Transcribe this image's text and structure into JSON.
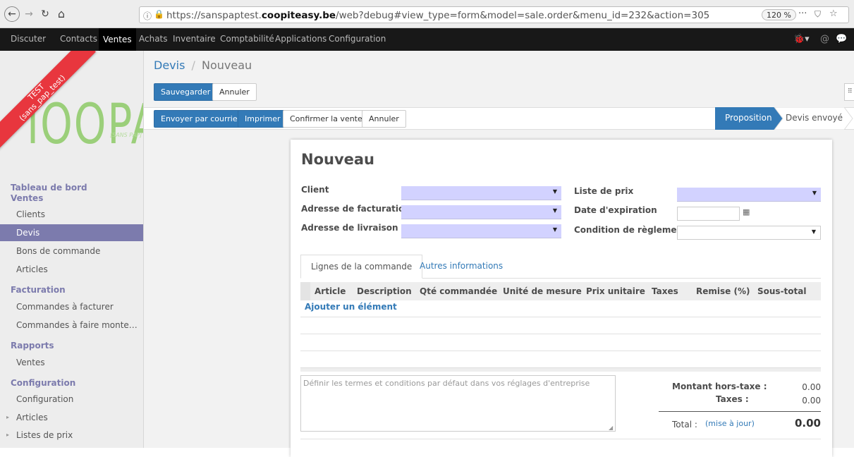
{
  "browser": {
    "back": "←",
    "forward": "→",
    "reload": "↻",
    "home": "⌂",
    "url_prefix": "https://sanspaptest.",
    "url_domain": "coopiteasy.be",
    "url_rest": "/web?debug#view_type=form&model=sale.order&menu_id=232&action=305",
    "zoom": "120 %",
    "menu_dots": "···",
    "pocket_icon": "pocket-icon",
    "star_icon": "star-icon"
  },
  "topbar": {
    "menus": [
      "Discuter",
      "Contacts",
      "Ventes",
      "Achats",
      "Inventaire",
      "Comptabilité",
      "Applications",
      "Configuration"
    ],
    "active": "Ventes"
  },
  "sidebar": {
    "ribbon_line1": "TEST",
    "ribbon_line2": "(sans_pap_test)",
    "logo": "IOOPAP",
    "logo_sub": "[SANS PAP]",
    "sections": [
      {
        "title": "Tableau de bord",
        "subtitle": "Ventes"
      },
      {
        "title": "Facturation"
      },
      {
        "title": "Rapports"
      },
      {
        "title": "Configuration"
      }
    ],
    "items": [
      "Clients",
      "Devis",
      "Bons de commande",
      "Articles",
      "Commandes à facturer",
      "Commandes à faire monte…",
      "Ventes",
      "Configuration",
      "Articles",
      "Listes de prix"
    ],
    "active_item": "Devis"
  },
  "breadcrumb": {
    "parent": "Devis",
    "sep": "/",
    "current": "Nouveau"
  },
  "buttons": {
    "save": "Sauvegarder",
    "discard": "Annuler",
    "send_email": "Envoyer par courriel",
    "print": "Imprimer",
    "confirm": "Confirmer la vente",
    "cancel": "Annuler"
  },
  "statusbar": {
    "stages": [
      "Proposition",
      "Devis envoyé"
    ],
    "active": "Proposition"
  },
  "form": {
    "title": "Nouveau",
    "left_fields": [
      {
        "label": "Client",
        "value": ""
      },
      {
        "label": "Adresse de facturation",
        "value": ""
      },
      {
        "label": "Adresse de livraison",
        "value": ""
      }
    ],
    "right_fields": [
      {
        "label": "Liste de prix",
        "value": ""
      },
      {
        "label": "Date d'expiration",
        "value": ""
      },
      {
        "label": "Condition de règlement",
        "value": ""
      }
    ],
    "tabs": [
      "Lignes de la commande",
      "Autres informations"
    ],
    "active_tab": "Lignes de la commande",
    "columns": [
      "Article",
      "Description",
      "Qté commandée",
      "Unité de mesure",
      "Prix unitaire",
      "Taxes",
      "Remise (%)",
      "Sous-total"
    ],
    "add_line": "Ajouter un élément",
    "note_placeholder": "Définir les termes et conditions par défaut dans vos réglages d'entreprise",
    "totals": {
      "untaxed_label": "Montant hors-taxe :",
      "untaxed_value": "0.00",
      "taxes_label": "Taxes :",
      "taxes_value": "0.00",
      "total_label": "Total :",
      "update_link": "(mise à jour)",
      "total_value": "0.00"
    }
  },
  "colors": {
    "accent": "#7c7bad",
    "primary": "#337ab7",
    "ribbon": "#e8363e",
    "logo": "#9bcf7a",
    "field_required": "#d2d2ff"
  }
}
